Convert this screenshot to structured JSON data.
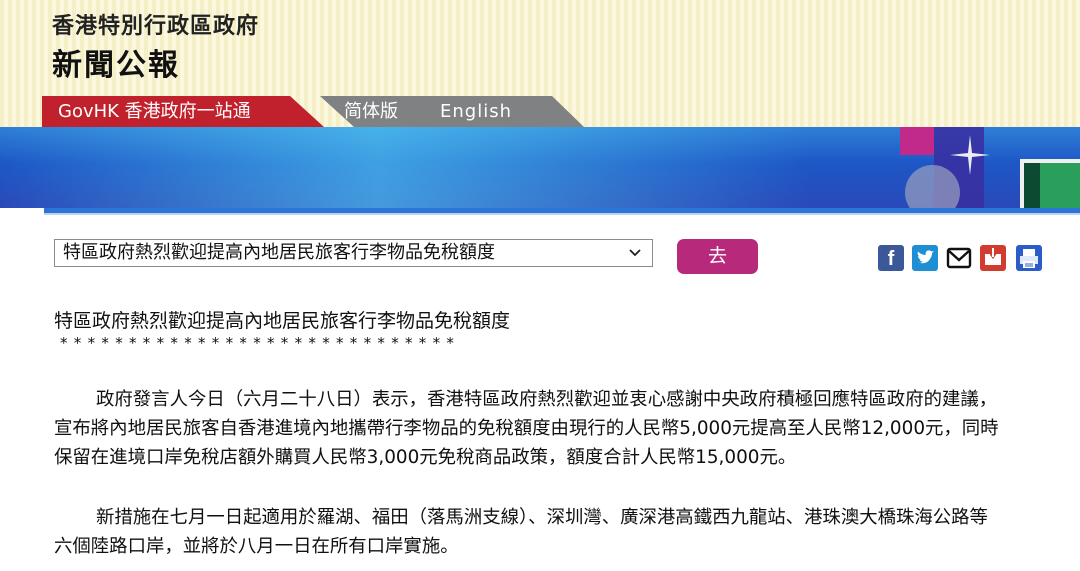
{
  "header": {
    "gov_title": "香港特別行政區政府",
    "press_title": "新聞公報"
  },
  "tabs": {
    "govhk": "GovHK 香港政府一站通",
    "simplified": "简体版",
    "english": "English"
  },
  "controls": {
    "select_value": "特區政府熱烈歡迎提高內地居民旅客行李物品免稅額度",
    "go_label": "去"
  },
  "share_icons": [
    "facebook-icon",
    "twitter-icon",
    "mail-icon",
    "inbox-icon",
    "print-icon"
  ],
  "article": {
    "headline": "特區政府熱烈歡迎提高內地居民旅客行李物品免稅額度",
    "stars": "*****************************",
    "paragraph1_lines": [
      "政府發言人今日（六月二十八日）表示，香港特區政府熱烈歡迎並衷心感謝中央政府積極回應特區政府的建議，",
      "宣布將內地居民旅客自香港進境內地攜帶行李物品的免稅額度由現行的人民幣5,000元提高至人民幣12,000元，同時",
      "保留在進境口岸免稅店額外購買人民幣3,000元免稅商品政策，額度合計人民幣15,000元。"
    ],
    "paragraph2_lines": [
      "新措施在七月一日起適用於羅湖、福田（落馬洲支線）、深圳灣、廣深港高鐵西九龍站、港珠澳大橋珠海公路等",
      "六個陸路口岸，並將於八月一日在所有口岸實施。"
    ]
  },
  "colors": {
    "govhk_tab": "#c0212d",
    "lang_tab": "#7f8182",
    "go_button": "#b7297b",
    "banner": "#1d57c6"
  }
}
